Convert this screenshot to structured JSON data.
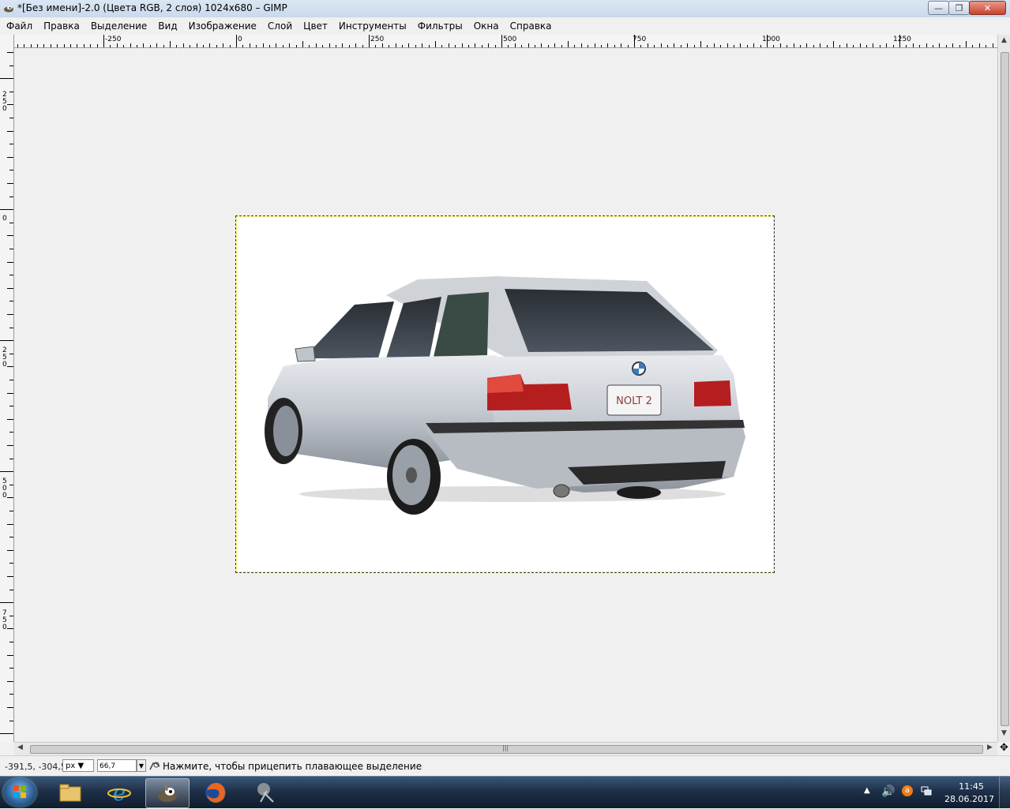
{
  "window": {
    "title": "*[Без имени]-2.0 (Цвета RGB, 2 слоя) 1024x680 – GIMP",
    "icon": "gimp-wilber-icon",
    "controls": {
      "minimize": "minimize-icon",
      "maximize": "restore-icon",
      "close": "close-icon"
    }
  },
  "menu": {
    "items": [
      "Файл",
      "Правка",
      "Выделение",
      "Вид",
      "Изображение",
      "Слой",
      "Цвет",
      "Инструменты",
      "Фильтры",
      "Окна",
      "Справка"
    ]
  },
  "ruler_top": {
    "labels": [
      "-250",
      "0",
      "250",
      "500",
      "750",
      "1000",
      "1250"
    ]
  },
  "ruler_left": {
    "labels": [
      "250",
      "0",
      "250",
      "500",
      "750"
    ]
  },
  "canvas": {
    "background": "#f0f0f0",
    "image_background": "#ffffff",
    "image_content": "silver BMW wagon rear view",
    "license_plate_text": "NOLT 2"
  },
  "statusbar": {
    "coords": "-391,5, -304,5",
    "unit": "px",
    "zoom": "66,7",
    "message": "Нажмите, чтобы прицепить плавающее выделение"
  },
  "taskbar": {
    "apps": [
      "windows-explorer-icon",
      "internet-explorer-icon",
      "gimp-icon",
      "firefox-icon",
      "snipping-tool-icon"
    ],
    "tray": [
      "show-hidden-icons-icon",
      "volume-icon",
      "avast-icon",
      "network-icon"
    ],
    "time": "11:45",
    "date": "28.06.2017"
  }
}
